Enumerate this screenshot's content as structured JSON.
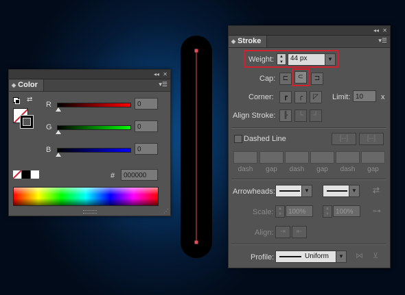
{
  "color_panel": {
    "tab": "Color",
    "collapse": "◂◂",
    "close": "✕",
    "r_label": "R",
    "g_label": "G",
    "b_label": "B",
    "r_value": "0",
    "g_value": "0",
    "b_value": "0",
    "hex_symbol": "#",
    "hex_value": "000000"
  },
  "stroke_panel": {
    "tab": "Stroke",
    "collapse": "◂◂",
    "close": "✕",
    "weight_label": "Weight:",
    "weight_value": "44 px",
    "cap_label": "Cap:",
    "corner_label": "Corner:",
    "limit_label": "Limit:",
    "limit_value": "10",
    "limit_unit": "x",
    "align_stroke_label": "Align Stroke:",
    "dashed_line_label": "Dashed Line",
    "dash_labels": [
      "dash",
      "gap",
      "dash",
      "gap",
      "dash",
      "gap"
    ],
    "arrowheads_label": "Arrowheads:",
    "scale_label": "Scale:",
    "scale_start": "100%",
    "scale_end": "100%",
    "align_label": "Align:",
    "profile_label": "Profile:",
    "profile_value": "Uniform"
  },
  "colors": {
    "highlight": "#d3202e",
    "panel": "#535353",
    "stroke_line": "#e0505a"
  }
}
